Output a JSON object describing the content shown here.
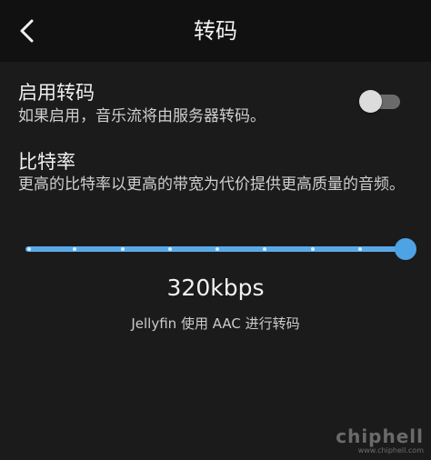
{
  "header": {
    "title": "转码",
    "back_icon": "chevron-left-icon"
  },
  "transcode_setting": {
    "title": "启用转码",
    "description": "如果启用，音乐流将由服务器转码。",
    "toggle_enabled": false
  },
  "bitrate_setting": {
    "title": "比特率",
    "description": "更高的比特率以更高的带宽为代价提供更高质量的音频。",
    "value_label": "320kbps",
    "slider_level": 1.0,
    "slider_steps": 9,
    "info_text": "Jellyfin 使用 AAC 进行转码"
  },
  "watermark": {
    "logo": "chiphell",
    "url": "www.chiphell.com"
  },
  "colors": {
    "background": "#1b1b1b",
    "header_background": "#111111",
    "accent": "#4ea3e4",
    "toggle_off_track": "#6a6a6a"
  }
}
